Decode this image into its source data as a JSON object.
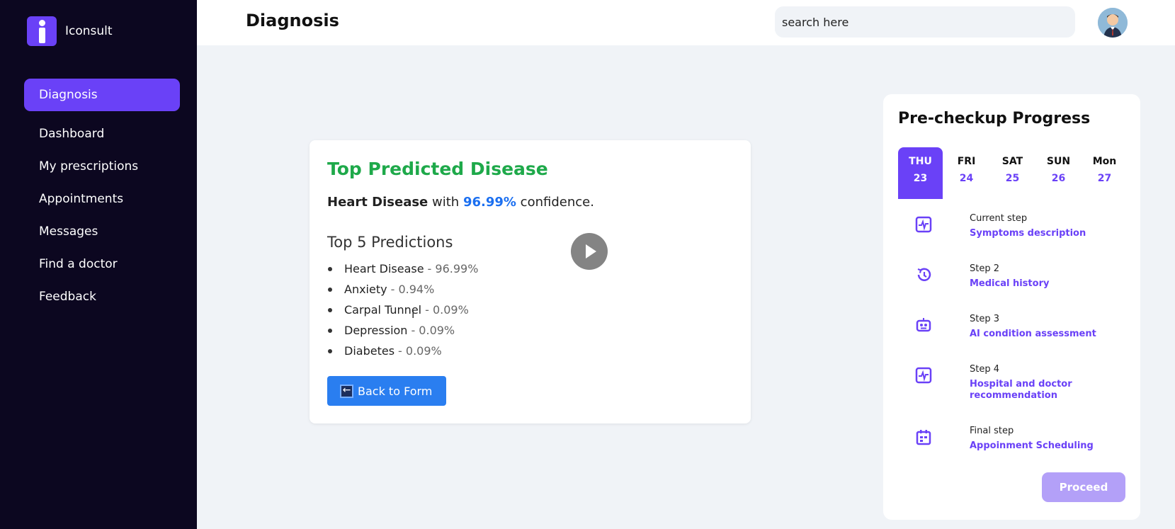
{
  "app": {
    "name": "Iconsult"
  },
  "sidebar": {
    "items": [
      {
        "label": "Diagnosis",
        "active": true
      },
      {
        "label": "Dashboard"
      },
      {
        "label": "My prescriptions"
      },
      {
        "label": "Appointments"
      },
      {
        "label": "Messages"
      },
      {
        "label": "Find a doctor"
      },
      {
        "label": "Feedback"
      }
    ]
  },
  "header": {
    "title": "Diagnosis",
    "search_placeholder": "search here"
  },
  "result": {
    "title": "Top Predicted Disease",
    "disease": "Heart Disease",
    "with_text": "with",
    "confidence": "96.99%",
    "confidence_suffix": "confidence.",
    "predictions_title": "Top 5 Predictions",
    "predictions": [
      {
        "name": "Heart Disease",
        "value": "- 96.99%"
      },
      {
        "name": "Anxiety",
        "value": "- 0.94%"
      },
      {
        "name": "Carpal Tunnel",
        "value": "- 0.09%"
      },
      {
        "name": "Depression",
        "value": "- 0.09%"
      },
      {
        "name": "Diabetes",
        "value": "- 0.09%"
      }
    ],
    "back_button": "Back to Form"
  },
  "progress": {
    "title": "Pre-checkup Progress",
    "days": [
      {
        "name": "THU",
        "date": "23",
        "active": true
      },
      {
        "name": "FRI",
        "date": "24"
      },
      {
        "name": "SAT",
        "date": "25"
      },
      {
        "name": "SUN",
        "date": "26"
      },
      {
        "name": "Mon",
        "date": "27"
      }
    ],
    "steps": [
      {
        "label": "Current step",
        "value": "Symptoms description",
        "icon": "activity-icon"
      },
      {
        "label": "Step 2",
        "value": "Medical history",
        "icon": "history-icon"
      },
      {
        "label": "Step 3",
        "value": "AI condition assessment",
        "icon": "robot-icon"
      },
      {
        "label": "Step 4",
        "value": "Hospital and doctor recommendation",
        "icon": "activity-icon"
      },
      {
        "label": "Final step",
        "value": "Appoinment Scheduling",
        "icon": "calendar-icon"
      }
    ],
    "proceed_button": "Proceed"
  },
  "colors": {
    "sidebar_bg": "#0c0720",
    "accent": "#6a41f7",
    "success": "#1ea94a",
    "link_blue": "#1b6ff0",
    "button_blue": "#2a7ef0",
    "proceed_disabled": "#b3a0f8"
  }
}
